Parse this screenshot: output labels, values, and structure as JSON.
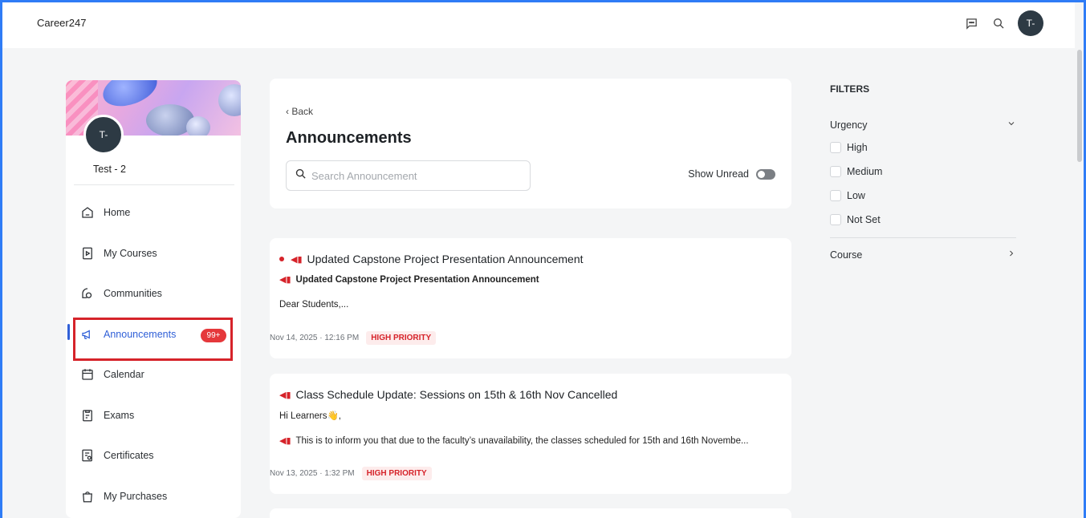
{
  "app": {
    "brand": "Career247",
    "user_initials": "T-"
  },
  "sidebar": {
    "user_name": "Test - 2",
    "avatar_initials": "T-",
    "items": [
      {
        "label": "Home",
        "icon": "home-icon"
      },
      {
        "label": "My Courses",
        "icon": "course-play-icon"
      },
      {
        "label": "Communities",
        "icon": "communities-icon"
      },
      {
        "label": "Announcements",
        "icon": "megaphone-icon",
        "badge": "99+",
        "active": true
      },
      {
        "label": "Calendar",
        "icon": "calendar-icon"
      },
      {
        "label": "Exams",
        "icon": "clipboard-icon"
      },
      {
        "label": "Certificates",
        "icon": "certificate-icon"
      },
      {
        "label": "My Purchases",
        "icon": "shopping-bag-icon"
      }
    ]
  },
  "main": {
    "back_label": "Back",
    "title": "Announcements",
    "search_placeholder": "Search Announcement",
    "show_unread_label": "Show Unread",
    "announcements": [
      {
        "title": "Updated Capstone Project Presentation Announcement",
        "subtitle": "Updated Capstone Project Presentation Announcement",
        "body": "Dear Students,...",
        "date": "Nov 14, 2025 · 12:16 PM",
        "priority": "HIGH PRIORITY"
      },
      {
        "title": "Class Schedule Update: Sessions on 15th & 16th Nov Cancelled",
        "greeting": "Hi Learners👋,",
        "body": "This is to inform you that due to the faculty’s unavailability, the classes scheduled for 15th and 16th Novembe...",
        "date": "Nov 13, 2025 · 1:32 PM",
        "priority": "HIGH PRIORITY"
      }
    ]
  },
  "filters": {
    "title": "FILTERS",
    "urgency_label": "Urgency",
    "urgency_options": [
      "High",
      "Medium",
      "Low",
      "Not Set"
    ],
    "course_label": "Course"
  },
  "colors": {
    "accent": "#2f5fd7",
    "priority_red": "#d6232a",
    "highlight_border": "#d6232a"
  }
}
